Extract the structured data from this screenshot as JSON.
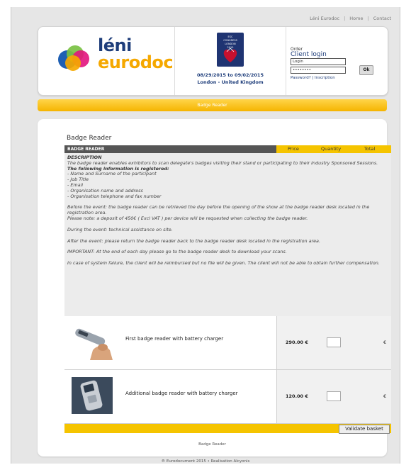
{
  "top_links": {
    "eurodoc": "Léni Eurodoc",
    "home": "Home",
    "contact": "Contact",
    "separator": "|"
  },
  "logo": {
    "line1": "léni",
    "line2": "eurodoc"
  },
  "event": {
    "badge_lines": [
      "ESC",
      "CONGRESS",
      "LONDON",
      "2015"
    ],
    "date": "08/29/2015 to 09/02/2015",
    "location": "London - United Kingdom"
  },
  "login": {
    "order": "Order",
    "client_login": "Client login",
    "login_value": "Login",
    "password_value": "••••••••",
    "ok": "Ok",
    "password_link": "Password?",
    "separator": "|",
    "inscription_link": "Inscription"
  },
  "nav": {
    "label": "Badge Reader"
  },
  "content": {
    "title": "Badge Reader",
    "footer_label": "Badge Reader"
  },
  "table": {
    "header": {
      "product": "BADGE READER",
      "price": "Price",
      "quantity": "Quantity",
      "total": "Total"
    },
    "description": {
      "heading": "DESCRIPTION",
      "intro": "The badge reader enables exhibitors to scan delegate's badges visiting their stand or participating to their Industry Sponsored Sessions.",
      "registered_heading": "The following information is registered:",
      "registered_items": [
        "- Name and Surname of the participant",
        "- Job Title",
        "- Email",
        "- Organisation name and address",
        "- Organisation telephone and fax number"
      ],
      "before_event": "Before the event: the badge reader can be retrieved the day before the opening of the show at the badge reader desk located in the registration area.",
      "deposit_note": "Please note: a deposit of 450€ ( Excl VAT ) per device will be requested when collecting the badge reader.",
      "during_event": "During the event: technical assistance on site.",
      "after_event": "After the event: please return the badge reader back to the badge reader desk located in the registration area.",
      "important": "IMPORTANT: At the end of each day please go to the badge reader desk to download your scans.",
      "failure": "In case of system failure, the client will be reimbursed but no file will be given. The client will not be able to obtain further compensation."
    },
    "products": [
      {
        "name": "First badge reader with battery charger",
        "price": "290.00 €",
        "total": "€"
      },
      {
        "name": "Additional badge reader with battery charger",
        "price": "120.00 €",
        "total": "€"
      }
    ],
    "validate_label": "Validate basket"
  },
  "copyright": "® Eurodocument 2015  •  Realisation Alcyonis",
  "colors": {
    "accent_yellow": "#f5c400",
    "brand_blue": "#1e3d7a",
    "brand_orange": "#f5a800",
    "header_dark": "#555555"
  }
}
